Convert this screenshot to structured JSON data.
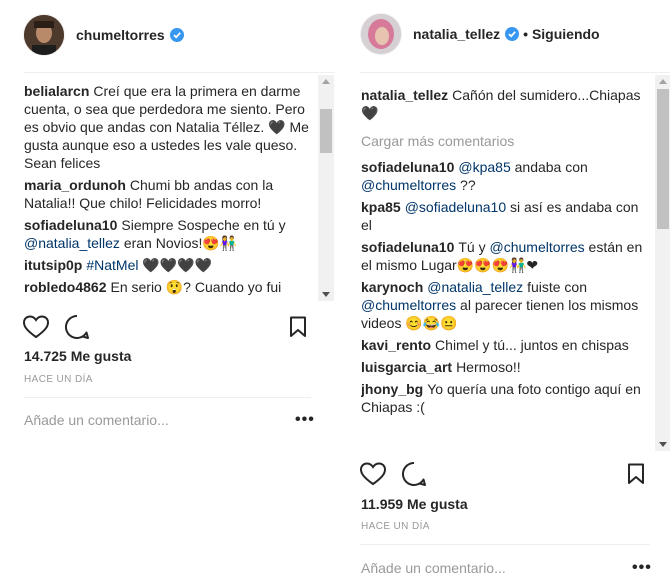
{
  "left_post": {
    "username": "chumeltorres",
    "comments": [
      {
        "user": "belialarcn",
        "parts": [
          {
            "text": "Creí que era la primera en darme cuenta, o sea que perdedora me siento. Pero es obvio que andas con Natalia Téllez. 🖤 Me gusta aunque eso a ustedes les vale queso. Sean felices"
          }
        ]
      },
      {
        "user": "maria_ordunoh",
        "parts": [
          {
            "text": "Chumi bb andas con la Natalia!! Que chilo! Felicidades morro!"
          }
        ]
      },
      {
        "user": "sofiadeluna10",
        "parts": [
          {
            "text": "Siempre Sospeche en tú y "
          },
          {
            "mention": "@natalia_tellez"
          },
          {
            "text": " eran Novios!😍👫"
          }
        ]
      },
      {
        "user": "itutsip0p",
        "parts": [
          {
            "mention": "#NatMel"
          },
          {
            "text": " 🖤🖤🖤🖤"
          }
        ]
      },
      {
        "user": "robledo4862",
        "parts": [
          {
            "text": "En serio 😲? Cuando yo fui"
          }
        ]
      }
    ],
    "likes": "14.725 Me gusta",
    "time": "HACE UN DÍA",
    "add_comment_placeholder": "Añade un comentario...",
    "more": "•••"
  },
  "right_post": {
    "username": "natalia_tellez",
    "following": "• Siguiendo",
    "caption_user": "natalia_tellez",
    "caption": "Cañón del sumidero...Chiapas 🖤",
    "load_more": "Cargar más comentarios",
    "comments": [
      {
        "user": "sofiadeluna10",
        "parts": [
          {
            "mention": "@kpa85"
          },
          {
            "text": " andaba con "
          },
          {
            "mention": "@chumeltorres"
          },
          {
            "text": " ??"
          }
        ]
      },
      {
        "user": "kpa85",
        "parts": [
          {
            "mention": "@sofiadeluna10"
          },
          {
            "text": " si así es andaba con el"
          }
        ]
      },
      {
        "user": "sofiadeluna10",
        "parts": [
          {
            "text": "Tú y "
          },
          {
            "mention": "@chumeltorres"
          },
          {
            "text": " están en el mismo Lugar😍😍😍👫❤"
          }
        ]
      },
      {
        "user": "karynoch",
        "parts": [
          {
            "mention": "@natalia_tellez"
          },
          {
            "text": " fuiste con "
          },
          {
            "mention": "@chumeltorres"
          },
          {
            "text": " al parecer tienen los mismos videos 😊😂😐"
          }
        ]
      },
      {
        "user": "kavi_rento",
        "parts": [
          {
            "text": "Chimel y tú... juntos en chispas"
          }
        ]
      },
      {
        "user": "luisgarcia_art",
        "parts": [
          {
            "text": "Hermoso!!"
          }
        ]
      },
      {
        "user": "jhony_bg",
        "parts": [
          {
            "text": "Yo quería una foto contigo aquí en Chiapas :("
          }
        ]
      }
    ],
    "likes": "11.959 Me gusta",
    "time": "HACE UN DÍA",
    "add_comment_placeholder": "Añade un comentario...",
    "more": "•••"
  },
  "colors": {
    "verified": "#3897f0",
    "mention": "#003569",
    "muted": "#999999"
  },
  "icons": [
    "verified-badge-icon",
    "heart-icon",
    "comment-icon",
    "bookmark-icon",
    "more-options-icon"
  ]
}
